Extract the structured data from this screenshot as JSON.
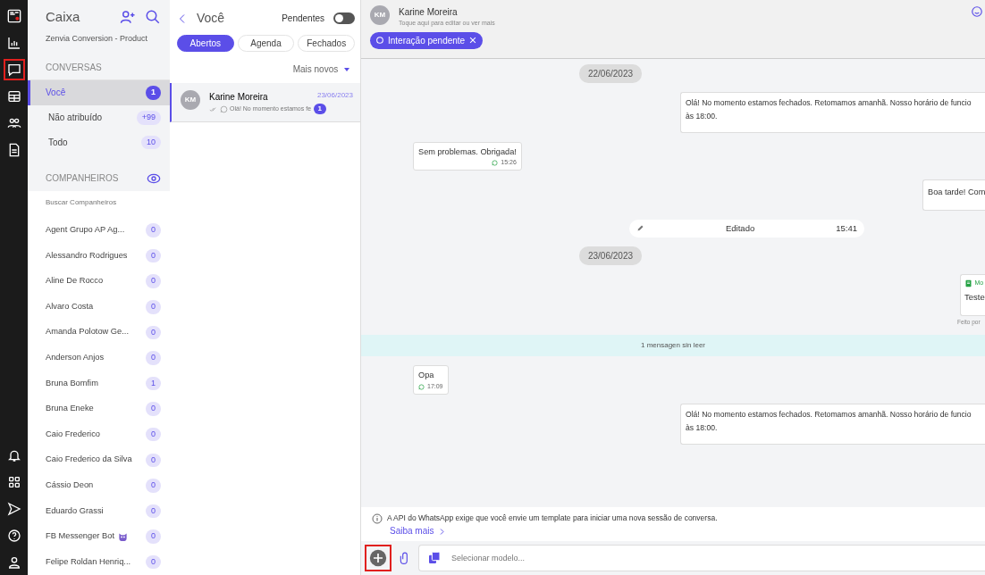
{
  "rail": {
    "top": [
      {
        "selected": false
      },
      {
        "selected": false
      },
      {
        "selected": true
      },
      {
        "selected": false
      },
      {
        "selected": false
      },
      {
        "selected": false
      }
    ],
    "bottom": [
      {
        "selected": false
      },
      {
        "selected": false
      },
      {
        "selected": false
      },
      {
        "selected": false
      },
      {
        "selected": false
      }
    ]
  },
  "sidebar": {
    "title": "Caixa",
    "account": "Zenvia Conversion - Product",
    "conversations_header": "CONVERSAS",
    "items": [
      {
        "label": "Você",
        "count": "1",
        "selected": true
      },
      {
        "label": "Não atribuído",
        "count": "+99",
        "selected": false
      },
      {
        "label": "Todo",
        "count": "10",
        "selected": false
      }
    ],
    "companions_header": "COMPANHEIROS",
    "search": {
      "placeholder": "Buscar Companheiros"
    },
    "agents": [
      {
        "name": "Agent Grupo AP Ag...",
        "count": "0"
      },
      {
        "name": "Alessandro Rodrigues",
        "count": "0"
      },
      {
        "name": "Aline De Rocco",
        "count": "0"
      },
      {
        "name": "Alvaro Costa",
        "count": "0"
      },
      {
        "name": "Amanda Polotow Ge...",
        "count": "0"
      },
      {
        "name": "Anderson Anjos",
        "count": "0"
      },
      {
        "name": "Bruna Bomfim",
        "count": "1"
      },
      {
        "name": "Bruna Eneke",
        "count": "0"
      },
      {
        "name": "Caio Frederico",
        "count": "0"
      },
      {
        "name": "Caio Frederico da Silva",
        "count": "0"
      },
      {
        "name": "Cássio Deon",
        "count": "0"
      },
      {
        "name": "Eduardo Grassi",
        "count": "0"
      },
      {
        "name": "FB Messenger Bot",
        "count": "0",
        "emoji": true
      },
      {
        "name": "Felipe Roldan Henriq...",
        "count": "0"
      }
    ]
  },
  "list": {
    "title": "Você",
    "pending_label": "Pendentes",
    "pending_on": false,
    "tabs": [
      {
        "label": "Abertos",
        "selected": true
      },
      {
        "label": "Agenda",
        "selected": false
      },
      {
        "label": "Fechados",
        "selected": false
      }
    ],
    "sort": "Mais novos",
    "conversations": [
      {
        "initials": "KM",
        "name": "Karine Moreira",
        "date": "23/06/2023",
        "preview": "Olá! No momento estamos fe",
        "unread": "1",
        "selected": true
      }
    ]
  },
  "chat": {
    "header": {
      "initials": "KM",
      "name": "Karine Moreira",
      "hint": "Toque aqui para editar ou ver mais",
      "tag": "Interação pendente"
    },
    "messages": [
      {
        "kind": "date",
        "text": "22/06/2023"
      },
      {
        "kind": "out",
        "lines": [
          "Olá! No momento estamos fechados. Retomamos amanhã. Nosso horário de funcio",
          "às 18:00."
        ]
      },
      {
        "kind": "in",
        "text": "Sem problemas. Obrigada!",
        "time": "15:26"
      },
      {
        "kind": "out_short",
        "lines": [
          "Boa tarde! Com"
        ]
      },
      {
        "kind": "edited",
        "text": "Editado",
        "time": "15:41"
      },
      {
        "kind": "date",
        "text": "23/06/2023"
      },
      {
        "kind": "template",
        "label": "Mo",
        "text": "Teste",
        "footer": "Feito por"
      },
      {
        "kind": "unread",
        "text": "1 mensagen sin leer"
      },
      {
        "kind": "in",
        "text": "Opa",
        "time": "17:09"
      },
      {
        "kind": "out",
        "lines": [
          "Olá! No momento estamos fechados. Retomamos amanhã. Nosso horário de funcio",
          "às 18:00."
        ]
      }
    ],
    "notice": {
      "text": "A API do WhatsApp exige que você envie um template para iniciar uma nova sessão de conversa.",
      "link": "Saiba mais"
    },
    "composer": {
      "add_highlighted": true,
      "placeholder": "Selecionar modelo..."
    }
  }
}
